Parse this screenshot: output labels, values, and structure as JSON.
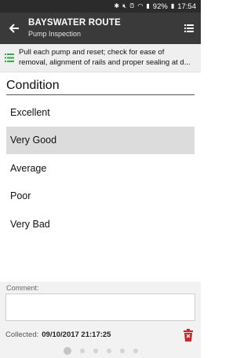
{
  "status_bar": {
    "battery": "92%",
    "time": "17:54"
  },
  "header": {
    "title": "BAYSWATER ROUTE",
    "subtitle": "Pump Inspection"
  },
  "instruction": {
    "line1": "Pull each pump and reset; check for ease of",
    "line2": "removal, alignment of rails and proper sealing at d..."
  },
  "section": {
    "title": "Condition"
  },
  "options": [
    {
      "label": "Excellent",
      "selected": false
    },
    {
      "label": "Very Good",
      "selected": true
    },
    {
      "label": "Average",
      "selected": false
    },
    {
      "label": "Poor",
      "selected": false
    },
    {
      "label": "Very Bad",
      "selected": false
    }
  ],
  "comment": {
    "label": "Comment:",
    "value": ""
  },
  "collected": {
    "label": "Collected:",
    "value": "09/10/2017 21:17:25"
  },
  "pager": {
    "count": 6,
    "active_index": 0
  },
  "colors": {
    "app_bar": "#3a3a3a",
    "status_bar": "#2b2b2b",
    "list_icon": "#2fae45",
    "trash_icon": "#c62828",
    "selected_row": "#dcdcdc"
  }
}
